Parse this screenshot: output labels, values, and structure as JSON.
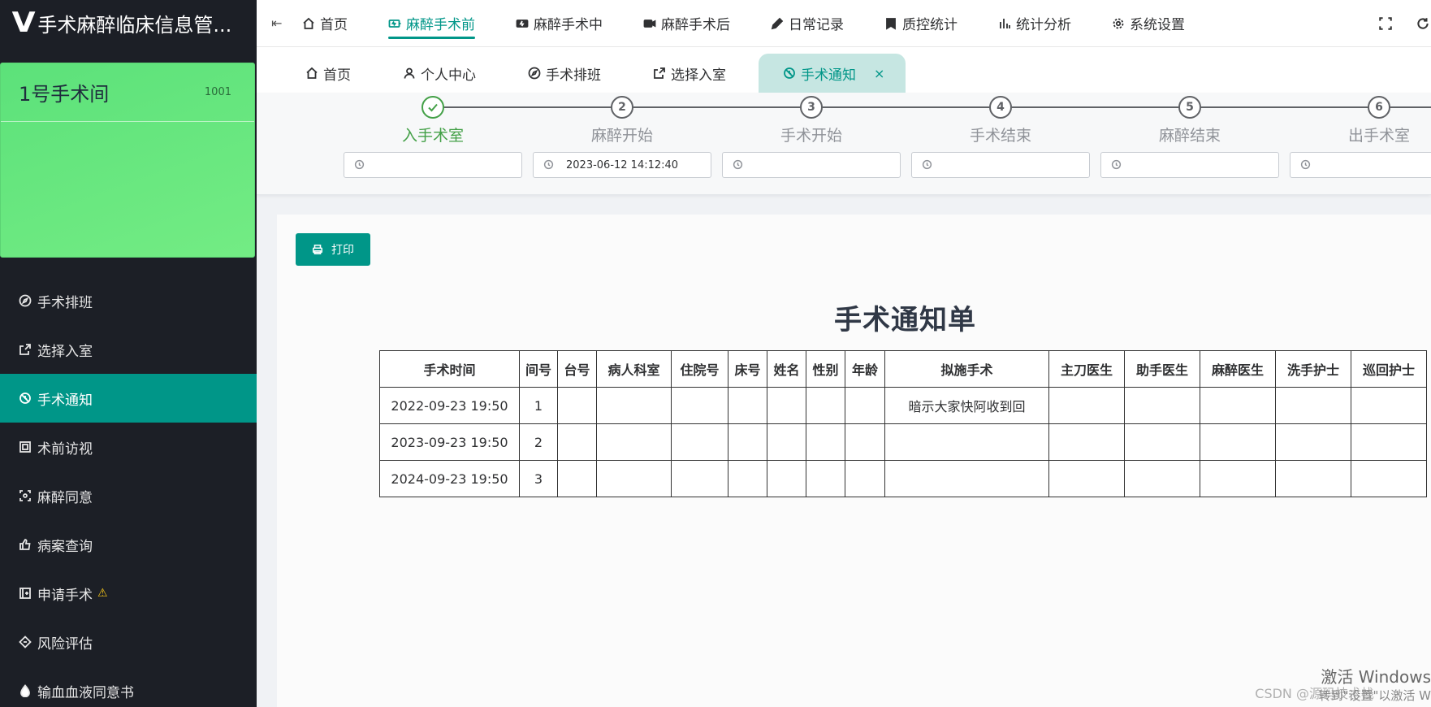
{
  "app": {
    "title": "手术麻醉临床信息管...",
    "logo_glyph": "V"
  },
  "room": {
    "name": "1号手术间",
    "code": "1001"
  },
  "sidebar": {
    "items": [
      {
        "label": "手术排班",
        "icon": "compass-icon",
        "active": false
      },
      {
        "label": "选择入室",
        "icon": "share-icon",
        "active": false
      },
      {
        "label": "手术通知",
        "icon": "bell-off-icon",
        "active": true
      },
      {
        "label": "术前访视",
        "icon": "frame-icon",
        "active": false
      },
      {
        "label": "麻醉同意",
        "icon": "scan-icon",
        "active": false
      },
      {
        "label": "病案查询",
        "icon": "thumb-icon",
        "active": false
      },
      {
        "label": "申请手术",
        "icon": "file-plus-icon",
        "active": false,
        "badge": "⚠"
      },
      {
        "label": "风险评估",
        "icon": "diamond-icon",
        "active": false
      },
      {
        "label": "输血血液同意书",
        "icon": "drop-icon",
        "active": false
      }
    ]
  },
  "topnav": {
    "items": [
      {
        "label": "首页",
        "icon": "home-icon",
        "active": false
      },
      {
        "label": "麻醉手术前",
        "icon": "battery-icon",
        "active": true
      },
      {
        "label": "麻醉手术中",
        "icon": "bolt-icon",
        "active": false
      },
      {
        "label": "麻醉手术后",
        "icon": "video-icon",
        "active": false
      },
      {
        "label": "日常记录",
        "icon": "pen-icon",
        "active": false
      },
      {
        "label": "质控统计",
        "icon": "bookmark-icon",
        "active": false
      },
      {
        "label": "统计分析",
        "icon": "bar-chart-icon",
        "active": false
      },
      {
        "label": "系统设置",
        "icon": "gear-icon",
        "active": false
      }
    ]
  },
  "tabs": {
    "items": [
      {
        "label": "首页",
        "icon": "home-icon",
        "active": false
      },
      {
        "label": "个人中心",
        "icon": "user-icon",
        "active": false
      },
      {
        "label": "手术排班",
        "icon": "compass-icon",
        "active": false
      },
      {
        "label": "选择入室",
        "icon": "share-icon",
        "active": false
      },
      {
        "label": "手术通知",
        "icon": "bell-off-icon",
        "active": true,
        "close": "×"
      }
    ]
  },
  "steps": [
    {
      "number": "1",
      "title": "入手术室",
      "time": "",
      "done": true
    },
    {
      "number": "2",
      "title": "麻醉开始",
      "time": "2023-06-12 14:12:40",
      "done": false
    },
    {
      "number": "3",
      "title": "手术开始",
      "time": "",
      "done": false
    },
    {
      "number": "4",
      "title": "手术结束",
      "time": "",
      "done": false
    },
    {
      "number": "5",
      "title": "麻醉结束",
      "time": "",
      "done": false
    },
    {
      "number": "6",
      "title": "出手术室",
      "time": "",
      "done": false
    }
  ],
  "content": {
    "print_label": "打印",
    "doc_title": "手术通知单",
    "table": {
      "headers": [
        "手术时间",
        "间号",
        "台号",
        "病人科室",
        "住院号",
        "床号",
        "姓名",
        "性别",
        "年龄",
        "拟施手术",
        "主刀医生",
        "助手医生",
        "麻醉医生",
        "洗手护士",
        "巡回护士"
      ],
      "rows": [
        [
          "2022-09-23 19:50",
          "1",
          "",
          "",
          "",
          "",
          "",
          "",
          "",
          "暗示大家快阿收到回",
          "",
          "",
          "",
          "",
          ""
        ],
        [
          "2023-09-23 19:50",
          "2",
          "",
          "",
          "",
          "",
          "",
          "",
          "",
          "",
          "",
          "",
          "",
          "",
          ""
        ],
        [
          "2024-09-23 19:50",
          "3",
          "",
          "",
          "",
          "",
          "",
          "",
          "",
          "",
          "",
          "",
          "",
          "",
          ""
        ]
      ]
    }
  },
  "overlay": {
    "windows_line1": "激活 Windows",
    "windows_line2": "转到\"设置\"以激活 W",
    "csdn": "CSDN @源码技术栈"
  },
  "colors": {
    "accent": "#009688",
    "step_done": "#43a047",
    "sidebar_bg": "#1c1f26",
    "room_card": "#6be57f"
  }
}
